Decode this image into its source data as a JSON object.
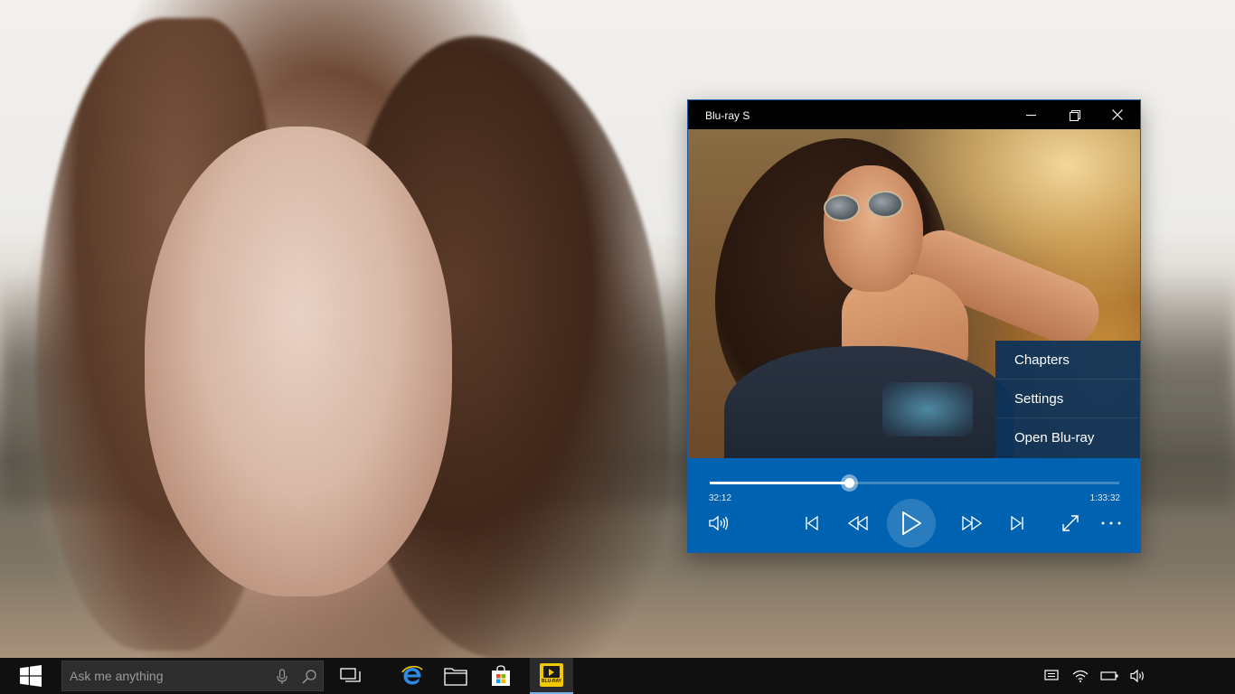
{
  "window": {
    "title": "Blu-ray S",
    "icons": {
      "minimize": "minimize-icon",
      "maximize": "restore-icon",
      "close": "close-icon"
    }
  },
  "menu": {
    "items": [
      {
        "label": "Chapters"
      },
      {
        "label": "Settings"
      },
      {
        "label": "Open Blu-ray"
      }
    ]
  },
  "player": {
    "elapsed": "32:12",
    "total": "1:33:32",
    "progress": 0.34,
    "state": "paused",
    "icons": {
      "volume": "volume-icon",
      "previous": "skip-previous-icon",
      "rewind": "rewind-icon",
      "play": "play-icon",
      "fast_forward": "fast-forward-icon",
      "next": "skip-next-icon",
      "fullscreen": "fullscreen-icon",
      "more": "more-options-icon"
    }
  },
  "taskbar": {
    "search_placeholder": "Ask me anything",
    "pinned": [
      {
        "name": "Task View",
        "icon": "task-view-icon"
      },
      {
        "name": "Internet Explorer",
        "icon": "edge-icon"
      },
      {
        "name": "File Explorer",
        "icon": "folder-icon"
      },
      {
        "name": "Store",
        "icon": "store-icon"
      },
      {
        "name": "Blu-ray Player",
        "icon": "bluray-app-icon",
        "active": true
      }
    ],
    "bluray_logo_text": "BLU-RAY",
    "tray": [
      "action-center-icon",
      "wifi-icon",
      "battery-icon",
      "speaker-icon"
    ]
  },
  "colors": {
    "accent": "#0063b1",
    "taskbar": "#101010",
    "titlebar": "#000000",
    "menu_bg": "#0c325a"
  }
}
